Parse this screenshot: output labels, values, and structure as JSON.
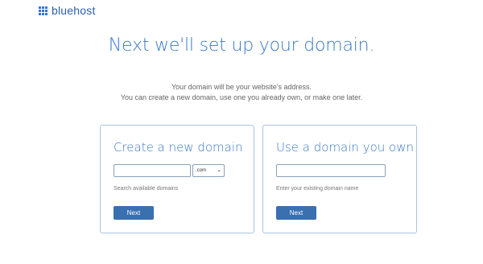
{
  "header": {
    "brand": "bluehost",
    "logo_icon": "grid-logo-icon"
  },
  "page": {
    "title": "Next we'll set up your domain.",
    "subtitle_line1": "Your domain will be your website's address.",
    "subtitle_line2": "You can create a new domain, use one you already own, or make one later."
  },
  "create_domain": {
    "title": "Create a new domain",
    "input_value": "",
    "tld_selected": ".com",
    "hint": "Search available domains",
    "button_label": "Next"
  },
  "own_domain": {
    "title": "Use a domain you own",
    "input_value": "",
    "hint": "Enter your existing domain name",
    "button_label": "Next"
  },
  "colors": {
    "accent": "#3a78c4",
    "button": "#3a6fb0",
    "card_border": "#a8c4e0"
  }
}
